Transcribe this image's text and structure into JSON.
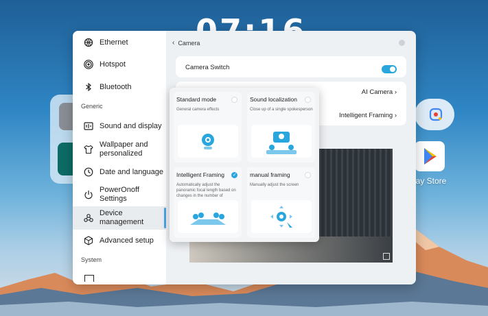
{
  "clock": {
    "time": "07:16"
  },
  "home": {
    "play_store_label": "lay Store"
  },
  "sidebar": {
    "items": [
      {
        "label": "Ethernet",
        "icon": "ethernet-icon"
      },
      {
        "label": "Hotspot",
        "icon": "hotspot-icon"
      },
      {
        "label": "Bluetooth",
        "icon": "bluetooth-icon"
      },
      {
        "label": "Sound and display",
        "icon": "sound-display-icon"
      },
      {
        "label": "Wallpaper and personalized",
        "icon": "wallpaper-icon"
      },
      {
        "label": "Date and language",
        "icon": "clock-icon"
      },
      {
        "label": "PowerOnoff Settings",
        "icon": "power-icon"
      },
      {
        "label": "Device management",
        "icon": "device-icon"
      },
      {
        "label": "Advanced setup",
        "icon": "advanced-icon"
      }
    ],
    "sections": {
      "generic": "Generic",
      "system": "System"
    },
    "active": "Device management"
  },
  "camera": {
    "back_label": "Camera",
    "switch_label": "Camera Switch",
    "switch_on": true,
    "ai_camera_value": "AI Camera",
    "framing_value": "Intelligent Framing"
  },
  "modes": [
    {
      "title": "Standard mode",
      "desc": "General camera effects",
      "selected": false
    },
    {
      "title": "Sound localization",
      "desc": "Close up of a single spokesperson",
      "selected": false
    },
    {
      "title": "Intelligent Framing",
      "desc": "Automatically adjust the panoramic focal length based on changes in the number of",
      "selected": true
    },
    {
      "title": "manual framing",
      "desc": "Manually adjust the screen",
      "selected": false
    }
  ],
  "colors": {
    "accent": "#2aa6df",
    "active_indicator": "#4aa6e6"
  }
}
